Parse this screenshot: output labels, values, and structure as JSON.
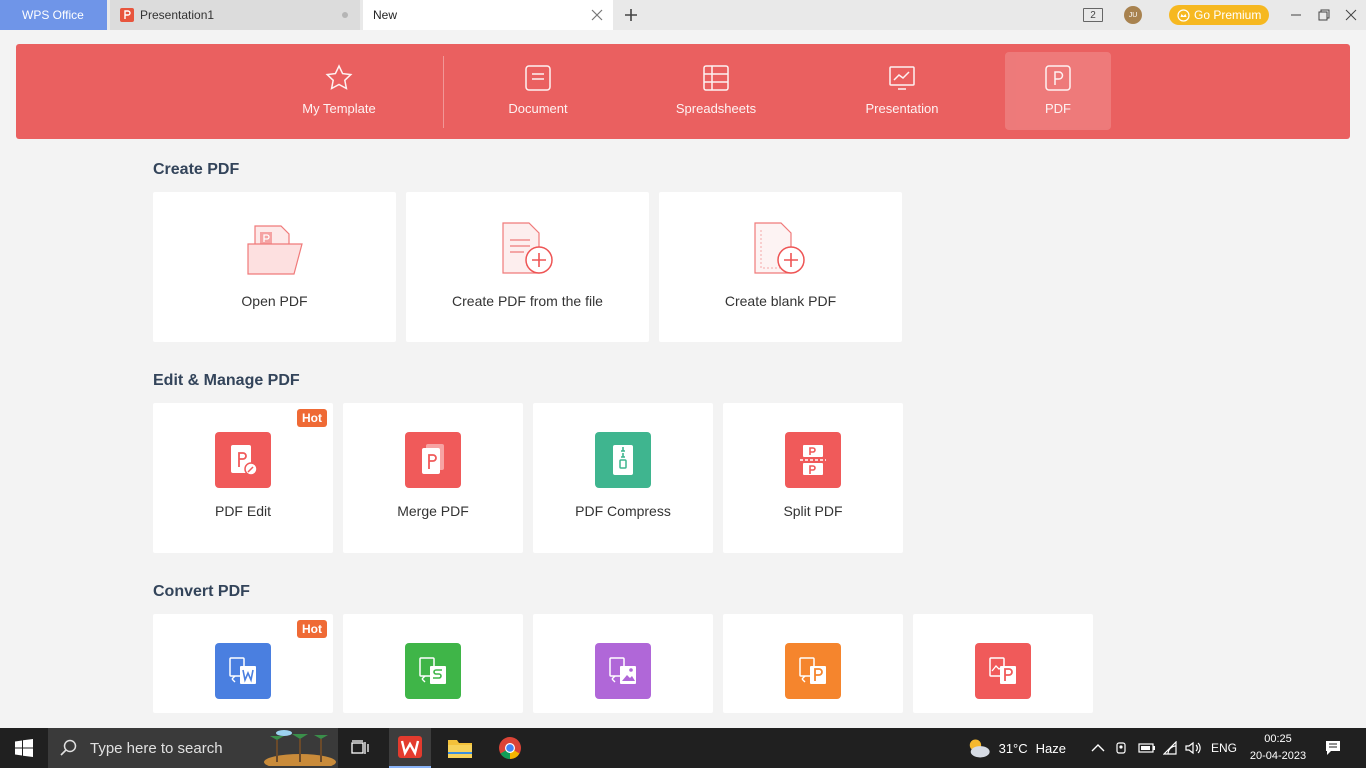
{
  "titlebar": {
    "app_tab": "WPS Office",
    "doc_tab": "Presentation1",
    "new_tab": "New",
    "window_count": "2",
    "avatar_initials": "JU",
    "premium_label": "Go Premium"
  },
  "banner": {
    "items": [
      {
        "label": "My Template",
        "icon": "star-icon"
      },
      {
        "label": "Document",
        "icon": "document-icon"
      },
      {
        "label": "Spreadsheets",
        "icon": "spreadsheet-icon"
      },
      {
        "label": "Presentation",
        "icon": "presentation-icon"
      },
      {
        "label": "PDF",
        "icon": "pdf-icon",
        "active": true
      }
    ]
  },
  "create_pdf": {
    "title": "Create PDF",
    "cards": [
      {
        "label": "Open PDF",
        "icon": "open-folder-icon"
      },
      {
        "label": "Create PDF from the file",
        "icon": "file-add-icon"
      },
      {
        "label": "Create blank PDF",
        "icon": "blank-file-add-icon"
      }
    ]
  },
  "edit_manage": {
    "title": "Edit & Manage PDF",
    "hot_label": "Hot",
    "cards": [
      {
        "label": "PDF Edit",
        "icon": "pdf-edit-icon",
        "color": "#f05a5a",
        "hot": true
      },
      {
        "label": "Merge PDF",
        "icon": "merge-pdf-icon",
        "color": "#f05a5a"
      },
      {
        "label": "PDF Compress",
        "icon": "zip-icon",
        "color": "#3fb58f"
      },
      {
        "label": "Split PDF",
        "icon": "split-pdf-icon",
        "color": "#f05a5a"
      }
    ]
  },
  "convert_pdf": {
    "title": "Convert PDF",
    "hot_label": "Hot",
    "cards": [
      {
        "icon": "pdf-to-word-icon",
        "color": "#4a7fe0",
        "hot": true
      },
      {
        "icon": "pdf-to-excel-icon",
        "color": "#3fb548"
      },
      {
        "icon": "pdf-to-image-icon",
        "color": "#b067d8"
      },
      {
        "icon": "pdf-to-ppt-icon",
        "color": "#f5852d"
      },
      {
        "icon": "image-to-pdf-icon",
        "color": "#f05a5a"
      }
    ]
  },
  "taskbar": {
    "search_placeholder": "Type here to search",
    "weather_temp": "31°C",
    "weather_desc": "Haze",
    "language": "ENG",
    "time": "00:25",
    "date": "20-04-2023"
  },
  "colors": {
    "banner": "#ea6060",
    "accent_red": "#f05a5a",
    "hot": "#ef6a35",
    "premium": "#f6b820",
    "tab_active": "#6f95e8"
  }
}
